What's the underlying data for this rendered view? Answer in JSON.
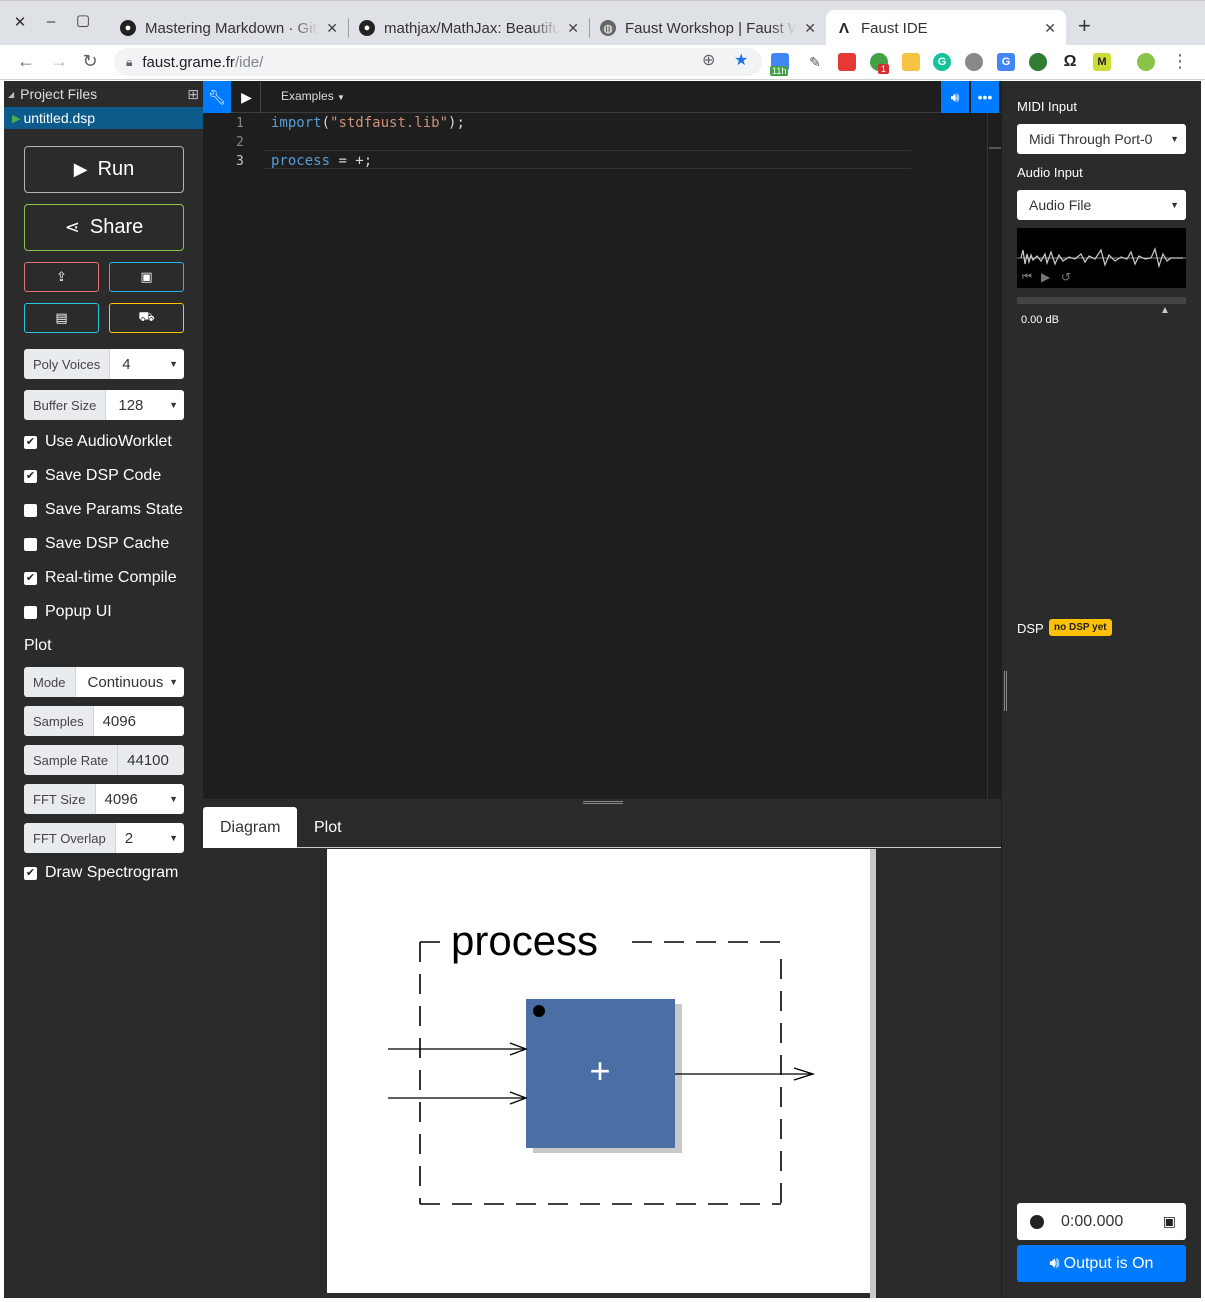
{
  "browser": {
    "tabs": [
      {
        "title": "Mastering Markdown · GitHub",
        "icon": "github-icon"
      },
      {
        "title": "mathjax/MathJax: Beautiful math",
        "icon": "github-icon"
      },
      {
        "title": "Faust Workshop | Faust Workshop",
        "icon": "globe-icon"
      },
      {
        "title": "Faust IDE",
        "icon": "faust-icon",
        "active": true
      }
    ],
    "url_host": "faust.grame.fr",
    "url_path": "/ide/",
    "extension_badge": "11h",
    "extension_count": "1"
  },
  "project": {
    "header": "Project Files",
    "file": "untitled.dsp"
  },
  "sidebar": {
    "run_label": "Run",
    "share_label": "Share",
    "poly_voices": {
      "label": "Poly Voices",
      "value": "4"
    },
    "buffer_size": {
      "label": "Buffer Size",
      "value": "128"
    },
    "checkboxes": [
      {
        "label": "Use AudioWorklet",
        "checked": true
      },
      {
        "label": "Save DSP Code",
        "checked": true
      },
      {
        "label": "Save Params State",
        "checked": false
      },
      {
        "label": "Save DSP Cache",
        "checked": false
      },
      {
        "label": "Real-time Compile",
        "checked": true
      },
      {
        "label": "Popup UI",
        "checked": false
      }
    ],
    "plot_title": "Plot",
    "mode": {
      "label": "Mode",
      "value": "Continuous"
    },
    "samples": {
      "label": "Samples",
      "value": "4096"
    },
    "sample_rate": {
      "label": "Sample Rate",
      "value": "44100"
    },
    "fft_size": {
      "label": "FFT Size",
      "value": "4096"
    },
    "fft_overlap": {
      "label": "FFT Overlap",
      "value": "2"
    },
    "draw_spectrogram": {
      "label": "Draw Spectrogram",
      "checked": true
    }
  },
  "editor": {
    "examples_label": "Examples",
    "lines": [
      {
        "number": "1",
        "keyword": "import",
        "rest_open": "(",
        "string": "\"stdfaust.lib\"",
        "rest_close": ");"
      },
      {
        "number": "2"
      },
      {
        "number": "3",
        "keyword": "process",
        "rest": " = +;"
      }
    ]
  },
  "bottom_tabs": {
    "diagram": "Diagram",
    "plot": "Plot"
  },
  "diagram": {
    "title": "process",
    "block_label": "+"
  },
  "right_panel": {
    "midi_input_label": "MIDI Input",
    "midi_input_value": "Midi Through Port-0",
    "audio_input_label": "Audio Input",
    "audio_input_value": "Audio File",
    "gain_value": "0.00 dB",
    "dsp_label": "DSP",
    "dsp_badge": "no DSP yet",
    "record_time": "0:00.000",
    "output_label": "Output is On"
  },
  "colors": {
    "accent_blue": "#007bff",
    "diagram_block": "#4a6fa5",
    "project_file_bg": "#0d5b8a",
    "badge_yellow": "#ffc107",
    "btn_run_border": "#6c757d",
    "btn_share_border": "#8bc34a"
  }
}
